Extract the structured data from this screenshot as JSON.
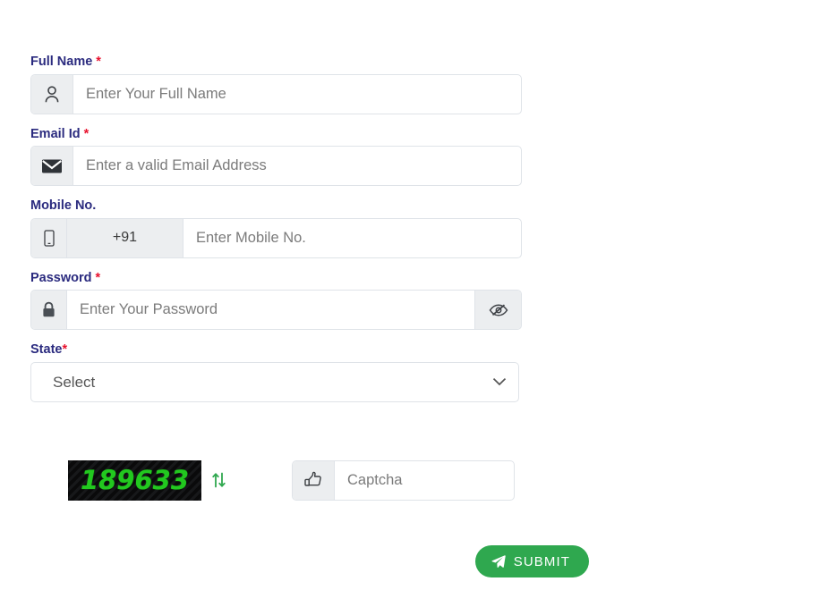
{
  "form": {
    "fields": {
      "full_name": {
        "label": "Full Name",
        "required_mark": "*",
        "placeholder": "Enter Your Full Name",
        "value": "",
        "icon": "user-icon"
      },
      "email": {
        "label": "Email Id",
        "required_mark": "*",
        "placeholder": "Enter a valid Email Address",
        "value": "",
        "icon": "envelope-icon"
      },
      "mobile": {
        "label": "Mobile No.",
        "required_mark": "",
        "country_code": "+91",
        "placeholder": "Enter Mobile No.",
        "value": "",
        "icon": "mobile-phone-icon"
      },
      "password": {
        "label": "Password",
        "required_mark": "*",
        "placeholder": "Enter Your Password",
        "value": "",
        "icon": "lock-icon",
        "toggle_icon": "eye-slash-icon"
      },
      "state": {
        "label": "State",
        "required_mark": "*",
        "selected": "Select",
        "options": [
          "Select"
        ],
        "icon": "chevron-down-icon"
      },
      "captcha": {
        "code": "189633",
        "placeholder": "Captcha",
        "value": "",
        "icon": "pointing-hand-icon",
        "refresh_icon": "refresh-arrows-icon"
      }
    },
    "submit": {
      "label": "SUBMIT",
      "icon": "paper-plane-icon"
    }
  },
  "colors": {
    "label": "#2b2b7f",
    "required": "#e8112d",
    "captcha_text": "#22c81f",
    "captcha_bg": "#111112",
    "submit_bg": "#2fa84f",
    "addon_bg": "#eceef0",
    "border": "#dfe3e8",
    "placeholder": "#7b7b7b"
  }
}
